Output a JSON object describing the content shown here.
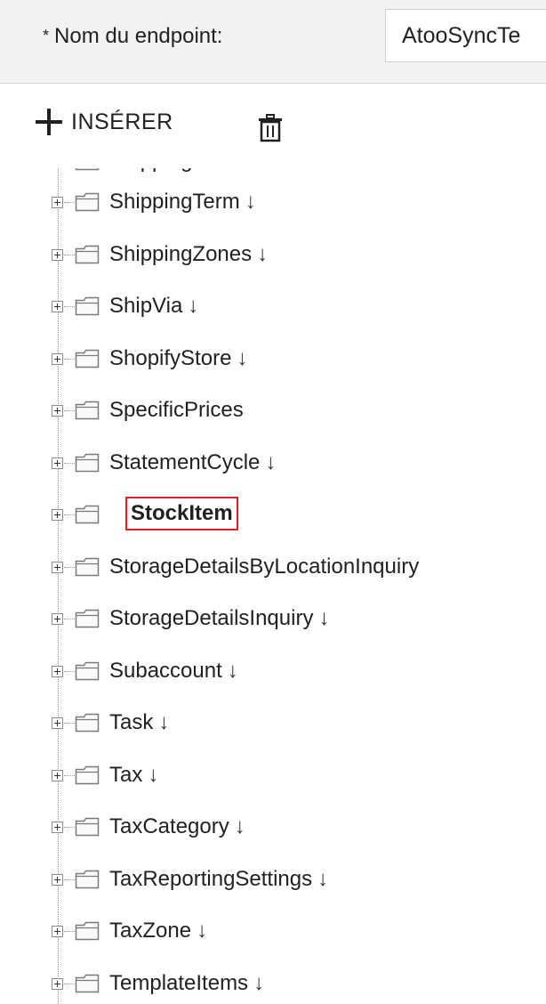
{
  "field": {
    "required_mark": "*",
    "label": "Nom du endpoint:",
    "value": "AtooSyncTe"
  },
  "toolbar": {
    "insert_label": "INSÉRER"
  },
  "tree": {
    "partial_top_item": "ShippingRules",
    "items": [
      {
        "label": "ShippingTerm",
        "arrow": "↓"
      },
      {
        "label": "ShippingZones",
        "arrow": "↓"
      },
      {
        "label": "ShipVia",
        "arrow": "↓"
      },
      {
        "label": "ShopifyStore",
        "arrow": "↓"
      },
      {
        "label": "SpecificPrices",
        "arrow": ""
      },
      {
        "label": "StatementCycle",
        "arrow": "↓"
      },
      {
        "label": "StockItem",
        "arrow": "",
        "selected": true
      },
      {
        "label": "StorageDetailsByLocationInquiry",
        "arrow": ""
      },
      {
        "label": "StorageDetailsInquiry",
        "arrow": "↓"
      },
      {
        "label": "Subaccount",
        "arrow": "↓"
      },
      {
        "label": "Task",
        "arrow": "↓"
      },
      {
        "label": "Tax",
        "arrow": "↓"
      },
      {
        "label": "TaxCategory",
        "arrow": "↓"
      },
      {
        "label": "TaxReportingSettings",
        "arrow": "↓"
      },
      {
        "label": "TaxZone",
        "arrow": "↓"
      },
      {
        "label": "TemplateItems",
        "arrow": "↓"
      }
    ]
  },
  "icons": {
    "insert": "plus-icon",
    "delete": "trash-icon",
    "expander": "plus-square-icon",
    "folder": "folder-icon"
  },
  "colors": {
    "selection_border": "#e02020",
    "header_background": "#f2f2f2"
  }
}
